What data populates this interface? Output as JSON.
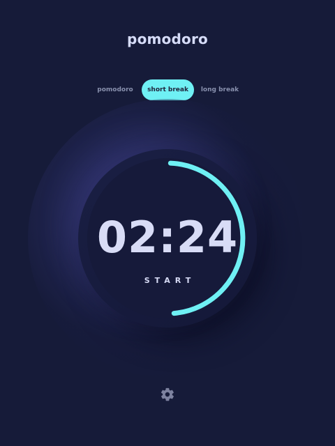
{
  "app": {
    "title": "pomodoro"
  },
  "tabs": [
    {
      "label": "pomodoro",
      "active": false
    },
    {
      "label": "short break",
      "active": true
    },
    {
      "label": "long break",
      "active": false
    }
  ],
  "timer": {
    "time": "02:24",
    "action_label": "START",
    "progress_fraction": 0.48
  },
  "icons": {
    "settings": "gear-icon"
  },
  "colors": {
    "background": "#161b39",
    "accent": "#6ff0f4",
    "text": "#d8dcf6",
    "muted": "#8890ad"
  }
}
